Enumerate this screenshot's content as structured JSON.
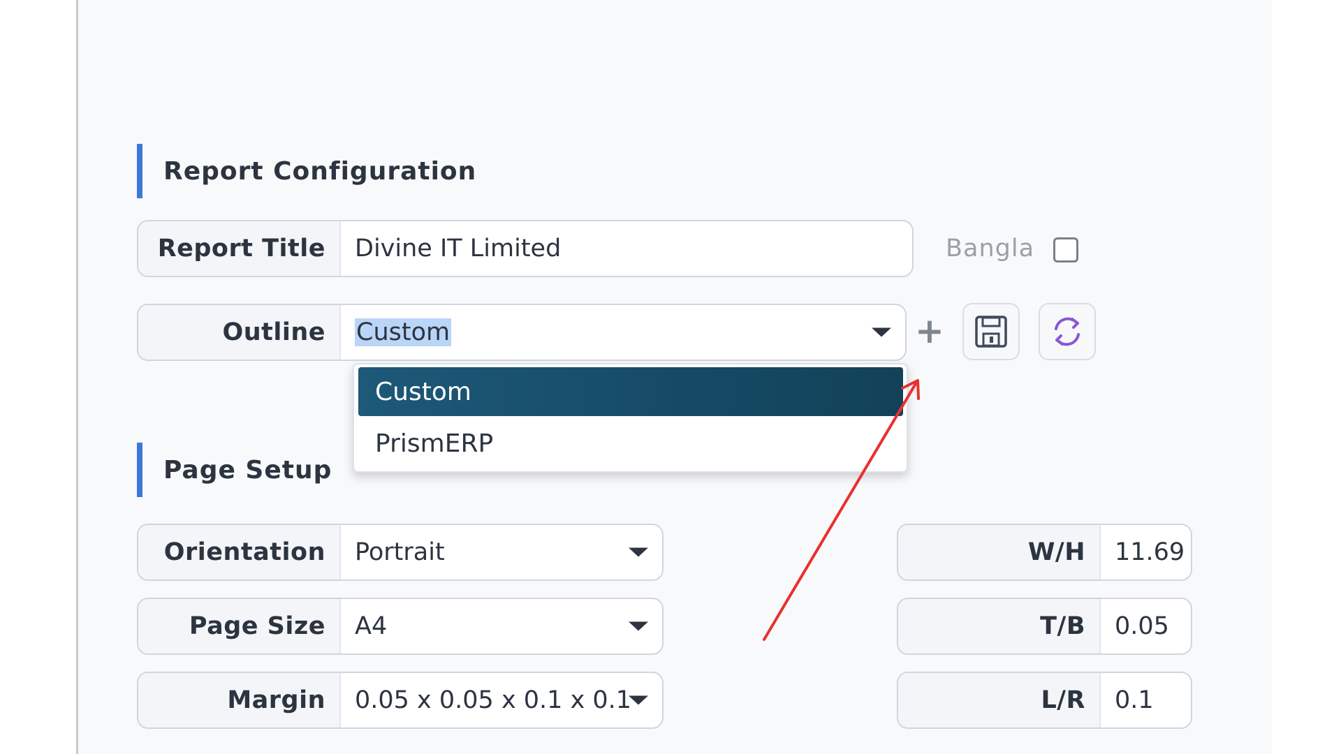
{
  "report_config": {
    "section_title": "Report Configuration",
    "report_title_label": "Report Title",
    "report_title_value": "Divine IT Limited",
    "bangla_label": "Bangla",
    "bangla_checked": false,
    "outline_label": "Outline",
    "outline_value": "Custom",
    "outline_options": [
      "Custom",
      "PrismERP"
    ]
  },
  "page_setup": {
    "section_title": "Page Setup",
    "orientation_label": "Orientation",
    "orientation_value": "Portrait",
    "page_size_label": "Page Size",
    "page_size_value": "A4",
    "margin_label": "Margin",
    "margin_value": "0.05 x 0.05 x 0.1 x 0.1",
    "wh_label": "W/H",
    "wh_value": "11.69",
    "tb_label": "T/B",
    "tb_value": "0.05",
    "lr_label": "L/R",
    "lr_value": "0.1"
  },
  "icons": {
    "add": "plus-icon",
    "save": "floppy-disk-icon",
    "refresh": "refresh-icon"
  },
  "colors": {
    "accent_bar": "#3a78d9",
    "dropdown_selected": "#1d5978",
    "annotation_arrow": "#e8302f"
  }
}
